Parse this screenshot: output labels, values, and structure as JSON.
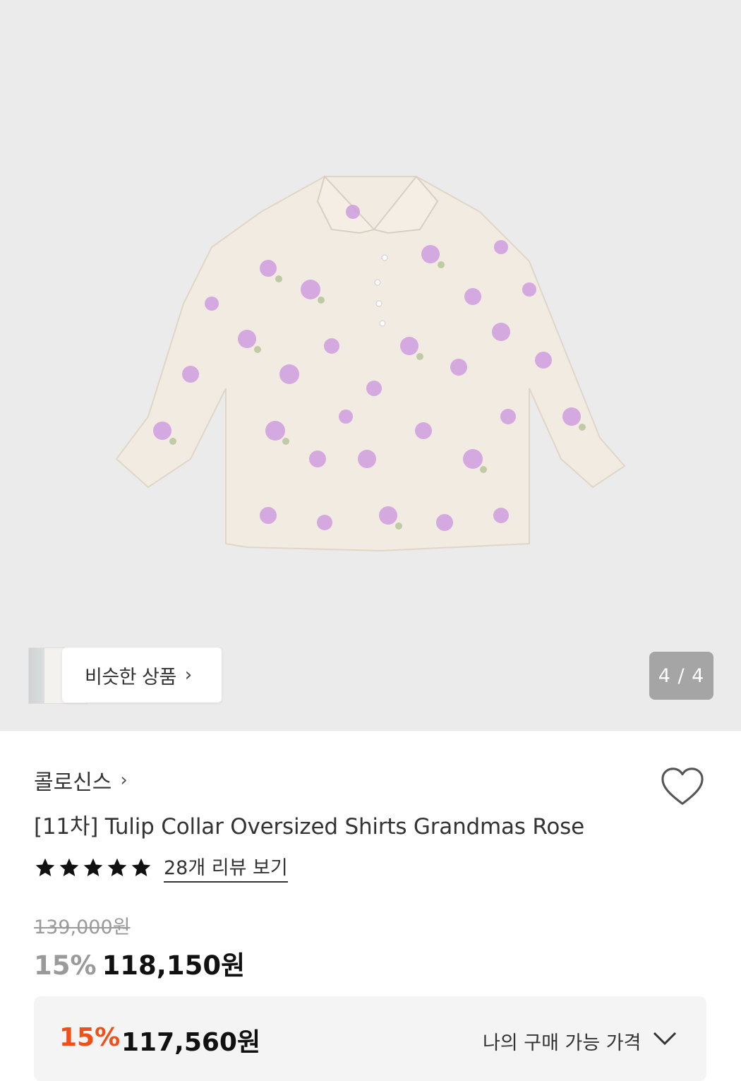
{
  "gallery": {
    "similar_label": "비슷한 상품",
    "similar_chevron": "›",
    "counter": "4 / 4"
  },
  "product": {
    "brand": "콜로신스",
    "brand_chevron": "›",
    "title": "[11차] Tulip Collar Oversized Shirts Grandmas Rose",
    "rating_stars": 5,
    "review_link": "28개 리뷰 보기",
    "original_price": "139,000원",
    "discount_percent": "15%",
    "sale_price": "118,150원"
  },
  "member_price": {
    "discount_percent": "15%",
    "price": "117,560원",
    "label": "나의 구매 가능 가격"
  },
  "colors": {
    "accent_orange": "#f14f19",
    "hero_bg": "#ebebeb",
    "counter_bg": "#a5a5a5"
  },
  "icons": {
    "wishlist": "heart-outline-icon",
    "rating": "star-icon",
    "expand": "chevron-down-icon"
  }
}
